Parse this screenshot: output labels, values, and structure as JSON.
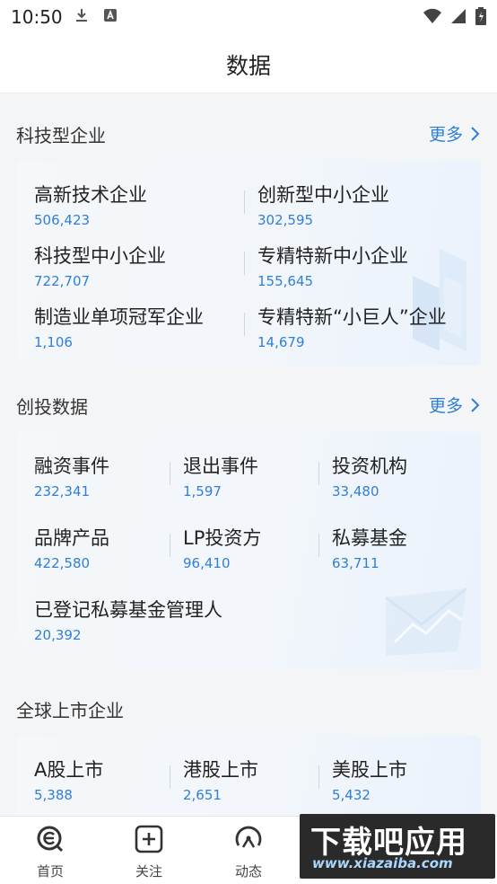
{
  "status": {
    "time": "10:50"
  },
  "header": {
    "title": "数据"
  },
  "sections": [
    {
      "title": "科技型企业",
      "more": "更多",
      "items": [
        {
          "name": "高新技术企业",
          "value": "506,423"
        },
        {
          "name": "创新型中小企业",
          "value": "302,595"
        },
        {
          "name": "科技型中小企业",
          "value": "722,707"
        },
        {
          "name": "专精特新中小企业",
          "value": "155,645"
        },
        {
          "name": "制造业单项冠军企业",
          "value": "1,106"
        },
        {
          "name": "专精特新“小巨人”企业",
          "value": "14,679"
        }
      ]
    },
    {
      "title": "创投数据",
      "more": "更多",
      "items": [
        {
          "name": "融资事件",
          "value": "232,341"
        },
        {
          "name": "退出事件",
          "value": "1,597"
        },
        {
          "name": "投资机构",
          "value": "33,480"
        },
        {
          "name": "品牌产品",
          "value": "422,580"
        },
        {
          "name": "LP投资方",
          "value": "96,410"
        },
        {
          "name": "私募基金",
          "value": "63,711"
        },
        {
          "name": "已登记私募基金管理人",
          "value": "20,392"
        }
      ]
    },
    {
      "title": "全球上市企业",
      "items": [
        {
          "name": "A股上市",
          "value": "5,388"
        },
        {
          "name": "港股上市",
          "value": "2,651"
        },
        {
          "name": "美股上市",
          "value": "5,432"
        }
      ]
    }
  ],
  "tabbar": {
    "tabs": [
      {
        "label": "首页",
        "icon": "home-e-icon"
      },
      {
        "label": "关注",
        "icon": "plus-square-icon"
      },
      {
        "label": "动态",
        "icon": "radar-icon"
      }
    ]
  },
  "watermark": {
    "main": "下载吧应用",
    "sub": "www.xiazaiba.com"
  },
  "colors": {
    "accent": "#2f7fd6",
    "text": "#222222",
    "card_bg": "#f2f6fb"
  }
}
